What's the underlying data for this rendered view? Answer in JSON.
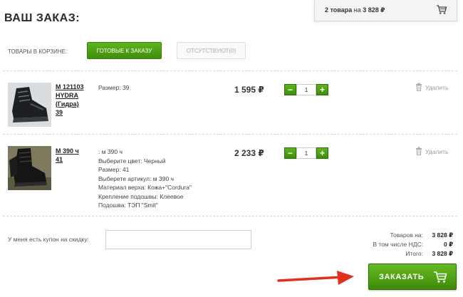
{
  "title": "ВАШ ЗАКАЗ:",
  "mini_cart": {
    "count_text": "2 товара",
    "on_text": "на",
    "sum": "3 828 ₽"
  },
  "tabs": {
    "label": "ТОВАРЫ В КОРЗИНЕ:",
    "ready": "ГОТОВЫЕ К ЗАКАЗУ",
    "missing": "ОТСУТСТВУЮТ(0)"
  },
  "items": [
    {
      "name": [
        "М 121103",
        "HYDRA",
        "(Гидра)",
        "39"
      ],
      "props": [
        "Размер: 39"
      ],
      "price": "1 595 ₽",
      "qty": "1",
      "delete": "Удалить"
    },
    {
      "name": [
        "М 390 ч",
        "41"
      ],
      "props": [
        ": м 390 ч",
        "Выберите цвет: Черный",
        "Размер: 41",
        "Выберете артикул: м 390 ч",
        "Материал верха: Кожа+\"Cordura\"",
        "Крепление подошвы: Клеевое",
        "Подошва: ТЭП \"Smit\""
      ],
      "price": "2 233 ₽",
      "qty": "1",
      "delete": "Удалить"
    }
  ],
  "coupon": {
    "label": "У меня есть купон на скидку:",
    "value": ""
  },
  "totals": {
    "goods_label": "Товаров на:",
    "goods_value": "3 828 ₽",
    "vat_label": "В том числе НДС:",
    "vat_value": "0 ₽",
    "total_label": "Итого:",
    "total_value": "3 828 ₽"
  },
  "order_button": "ЗАКАЗАТЬ",
  "colors": {
    "accent_green": "#4a9c12",
    "arrow_red": "#e0301e"
  }
}
